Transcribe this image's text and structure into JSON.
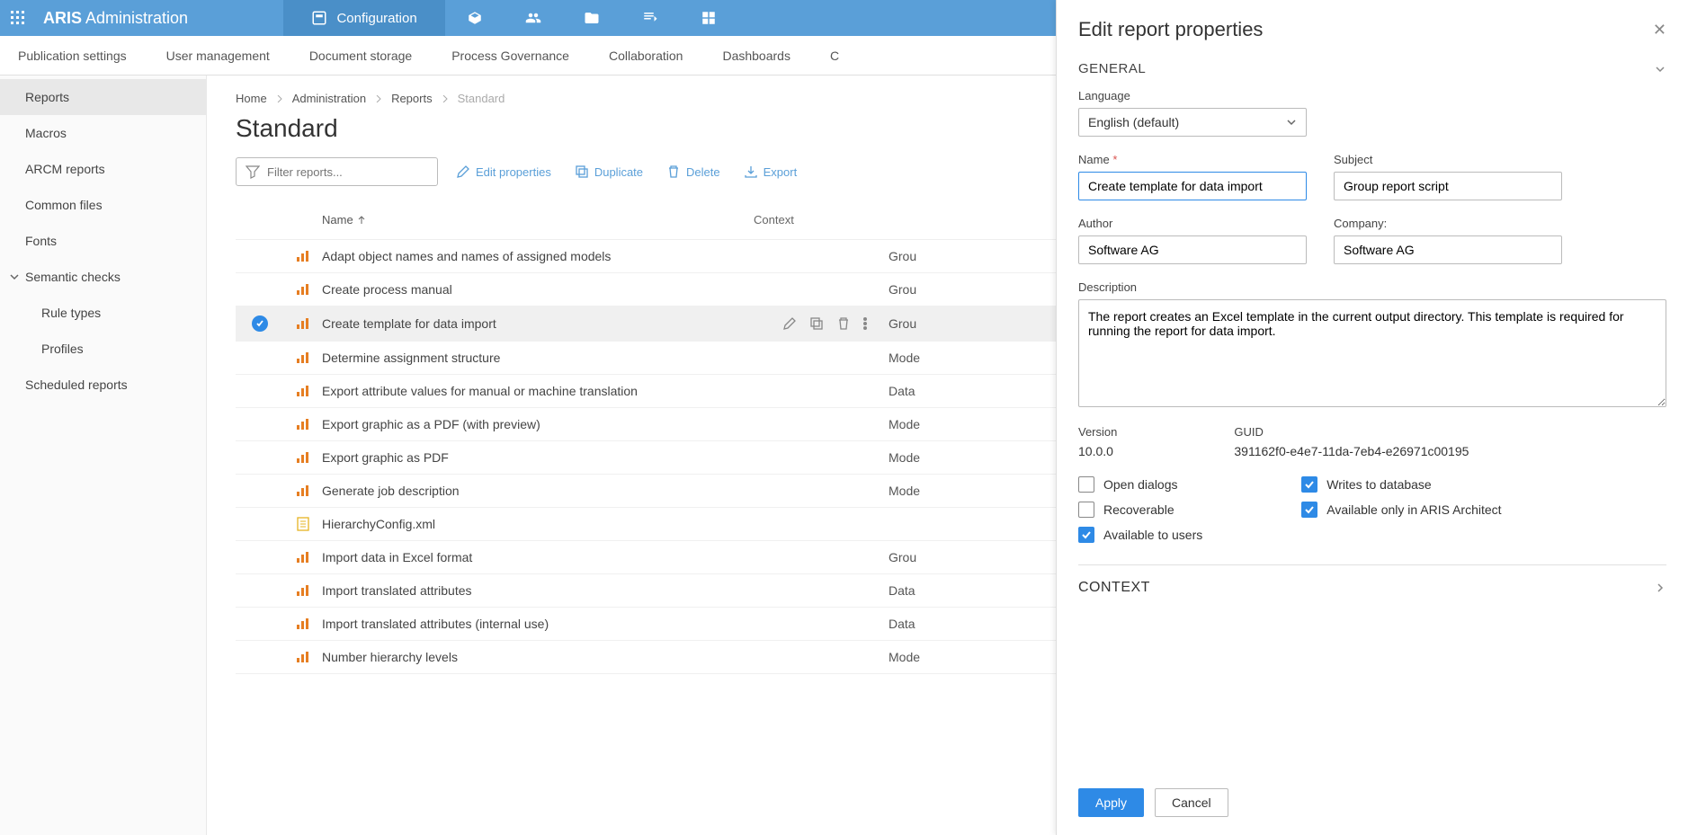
{
  "brand": {
    "bold": "ARIS",
    "light": " Administration"
  },
  "topNav": {
    "activeLabel": "Configuration"
  },
  "subTabs": [
    "Publication settings",
    "User management",
    "Document storage",
    "Process Governance",
    "Collaboration",
    "Dashboards",
    "C"
  ],
  "sidebar": {
    "items": [
      {
        "label": "Reports",
        "active": true
      },
      {
        "label": "Macros"
      },
      {
        "label": "ARCM reports"
      },
      {
        "label": "Common files"
      },
      {
        "label": "Fonts"
      },
      {
        "label": "Semantic checks",
        "expandable": true,
        "children": [
          "Rule types",
          "Profiles"
        ]
      },
      {
        "label": "Scheduled reports"
      }
    ]
  },
  "breadcrumb": {
    "items": [
      "Home",
      "Administration",
      "Reports"
    ],
    "current": "Standard"
  },
  "pageTitle": "Standard",
  "toolbar": {
    "filterPlaceholder": "Filter reports...",
    "editProperties": "Edit properties",
    "duplicate": "Duplicate",
    "delete": "Delete",
    "export": "Export"
  },
  "table": {
    "headers": {
      "name": "Name",
      "context": "Context"
    },
    "rows": [
      {
        "name": "Adapt object names and names of assigned models",
        "context": "Grou"
      },
      {
        "name": "Create process manual",
        "context": "Grou"
      },
      {
        "name": "Create template for data import",
        "context": "Grou",
        "selected": true
      },
      {
        "name": "Determine assignment structure",
        "context": "Mode"
      },
      {
        "name": "Export attribute values for manual or machine translation",
        "context": "Data"
      },
      {
        "name": "Export graphic as a PDF (with preview)",
        "context": "Mode"
      },
      {
        "name": "Export graphic as PDF",
        "context": "Mode"
      },
      {
        "name": "Generate job description",
        "context": "Mode"
      },
      {
        "name": "HierarchyConfig.xml",
        "context": "",
        "fileIcon": true
      },
      {
        "name": "Import data in Excel format",
        "context": "Grou"
      },
      {
        "name": "Import translated attributes",
        "context": "Data"
      },
      {
        "name": "Import translated attributes (internal use)",
        "context": "Data"
      },
      {
        "name": "Number hierarchy levels",
        "context": "Mode"
      }
    ]
  },
  "panel": {
    "title": "Edit report properties",
    "sectionGeneral": "GENERAL",
    "sectionContext": "CONTEXT",
    "labels": {
      "language": "Language",
      "name": "Name",
      "subject": "Subject",
      "author": "Author",
      "company": "Company:",
      "description": "Description",
      "version": "Version",
      "guid": "GUID"
    },
    "values": {
      "language": "English (default)",
      "name": "Create template for data import",
      "subject": "Group report script",
      "author": "Software AG",
      "company": "Software AG",
      "description": "The report creates an Excel template in the current output directory. This template is required for running the report for data import.",
      "version": "10.0.0",
      "guid": "391162f0-e4e7-11da-7eb4-e26971c00195"
    },
    "checks": {
      "openDialogs": "Open dialogs",
      "recoverable": "Recoverable",
      "availableUsers": "Available to users",
      "writesDb": "Writes to database",
      "availableArchitect": "Available only in ARIS Architect"
    },
    "buttons": {
      "apply": "Apply",
      "cancel": "Cancel"
    }
  }
}
